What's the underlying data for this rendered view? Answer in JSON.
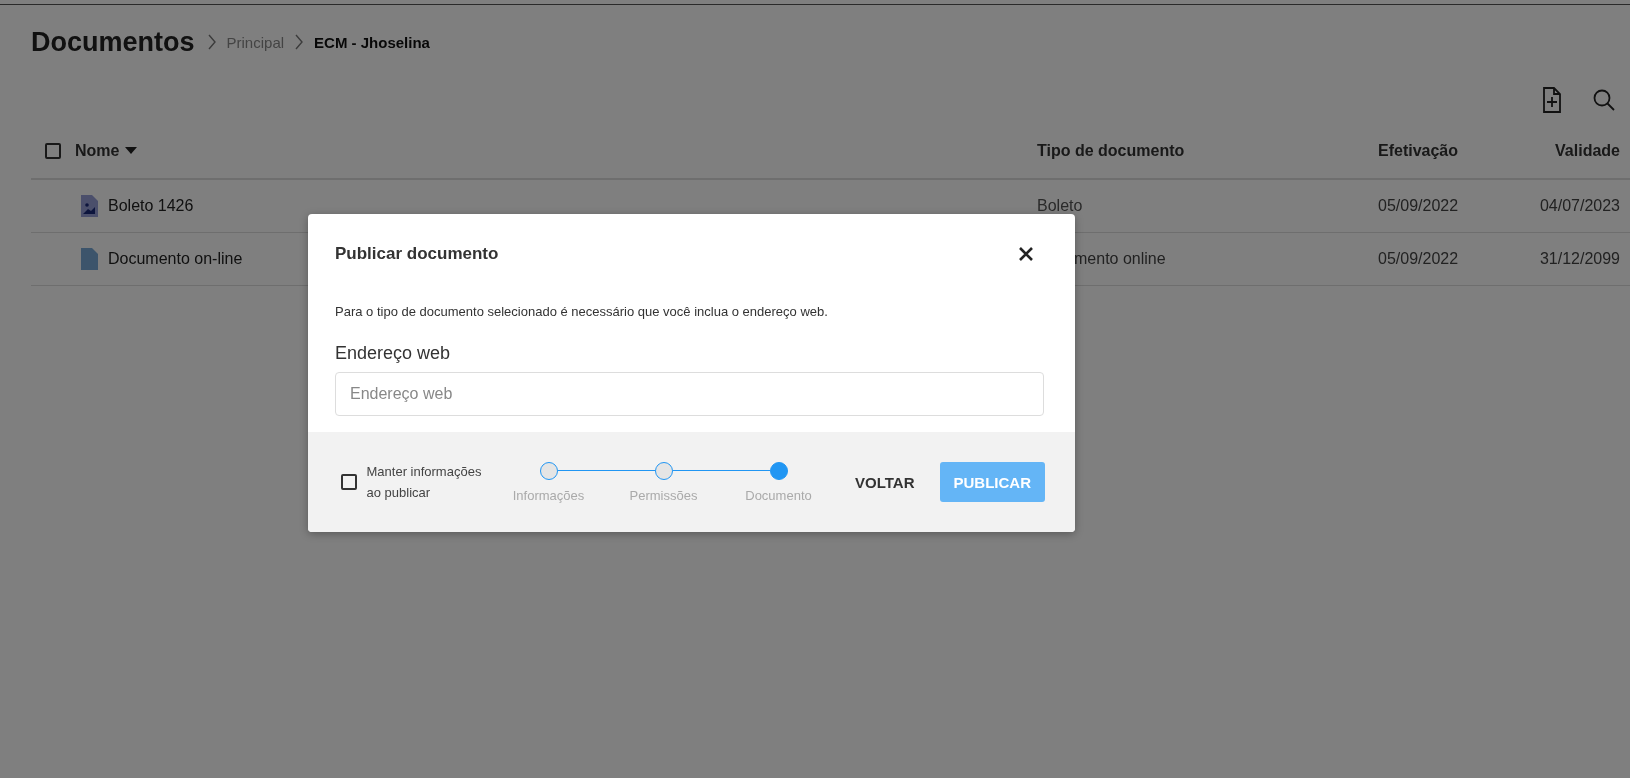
{
  "header": {
    "title": "Documentos",
    "breadcrumb": [
      {
        "label": "Principal",
        "current": false
      },
      {
        "label": "ECM - Jhoselina",
        "current": true
      }
    ]
  },
  "table": {
    "select_all": {
      "checked": false
    },
    "columns": [
      {
        "label": "Nome",
        "sorted": true
      },
      {
        "label": "Tipo de documento",
        "sorted": false
      },
      {
        "label": "Efetivação",
        "sorted": false
      },
      {
        "label": "Validade",
        "sorted": false
      }
    ],
    "rows": [
      {
        "name": "Boleto 1426",
        "kind": "image",
        "type": "Boleto",
        "type_covered": false,
        "effective": "05/09/2022",
        "valid": "04/07/2023"
      },
      {
        "name": "Documento on-line",
        "kind": "document",
        "type": "mento online",
        "type_covered": true,
        "effective": "05/09/2022",
        "valid": "31/12/2099"
      }
    ]
  },
  "dialog": {
    "title": "Publicar documento",
    "message": "Para o tipo de documento selecionado é necessário que você inclua o endereço web.",
    "field": {
      "label": "Endereço web",
      "placeholder": "Endereço web"
    },
    "keep": {
      "label": "Manter informações ao publicar",
      "checked": false
    },
    "steps": [
      {
        "label": "Informações",
        "selected": false
      },
      {
        "label": "Permissões",
        "selected": false
      },
      {
        "label": "Documento",
        "selected": true
      }
    ],
    "back": "VOLTAR",
    "publish": {
      "label": "PUBLICAR",
      "disabled": true
    }
  }
}
